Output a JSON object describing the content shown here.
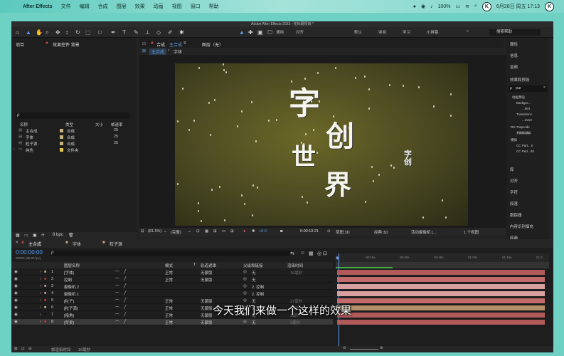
{
  "menubar": {
    "apple": "",
    "app": "After Effects",
    "items": [
      "文件",
      "编辑",
      "合成",
      "图层",
      "效果",
      "动画",
      "视图",
      "窗口",
      "帮助"
    ],
    "battery": "100%",
    "datetime": "6月28日 周五 17:13"
  },
  "window": {
    "title": "Adobe After Effects 2023 - 无标题项目 *"
  },
  "toolbar": {
    "snap": "通用",
    "align": "对齐",
    "workspaces": [
      "默认",
      "审阅",
      "学习",
      "小屏幕"
    ],
    "search_help": "搜索帮助"
  },
  "project": {
    "tab": "项目",
    "tab2": "效果控件 背景",
    "search": "ρ",
    "headers": {
      "name": "名称",
      "type": "类型",
      "size": "大小",
      "fps": "帧速率"
    },
    "items": [
      {
        "name": "主合成",
        "color": "#c8b27a",
        "type": "合成",
        "fps": "25"
      },
      {
        "name": "字体",
        "color": "#c8b27a",
        "type": "合成",
        "fps": "25"
      },
      {
        "name": "粒子源",
        "color": "#c8b27a",
        "type": "合成",
        "fps": "25"
      },
      {
        "name": "纯色",
        "color": "#e8c84a",
        "type": "文件夹",
        "fps": ""
      }
    ],
    "bpc": "8 bpc"
  },
  "comp": {
    "tab": "合成",
    "comp_name": "主合成",
    "footage": "图层（无）",
    "crumb1": "主合成",
    "crumb2": "字体",
    "zoom": "(81.5%)",
    "res": "(完整)",
    "exposure": "+0.0",
    "timecode": "0:00:10:21",
    "renderer": "草图 3D",
    "view3d": "经典 3D",
    "camera": "活动摄像机 (...",
    "views": "1 个视图"
  },
  "title_chars": [
    "字",
    "创",
    "世",
    "界"
  ],
  "right": {
    "items": [
      "属性",
      "信息",
      "音频",
      "效果和预设"
    ],
    "search": "par",
    "tree": [
      "动画预设",
      "Backgro...",
      "...ient",
      "Transitions",
      "...ment",
      "RG Trapcode",
      "Particular",
      "模拟",
      "CC Part... II",
      "CC Part...rld"
    ],
    "lower": [
      "库",
      "对齐",
      "字符",
      "段落",
      "跟踪器",
      "内容识别填充",
      "绘画"
    ]
  },
  "timeline": {
    "tabs": [
      "主合成",
      "字体",
      "粒子源"
    ],
    "timecode": "0:00:00:00",
    "fps_sub": "00000 (25.00 fps)",
    "headers": {
      "name": "图层名称",
      "mode": "模式",
      "t": "T",
      "trkmat": "轨道遮罩",
      "parent": "父级和链接",
      "render": "渲染时间"
    },
    "ruler": [
      "0s",
      "00:15s",
      "00:30s",
      "00:45s",
      "01:00s",
      "01:15s",
      "01:3"
    ],
    "layers": [
      {
        "num": "1",
        "name": "[字体]",
        "color": "#c8b27a",
        "mode": "正常",
        "trk": "无蒙版",
        "parent": "无",
        "render": "16毫秒"
      },
      {
        "num": "2",
        "name": "控制",
        "color": "#c33",
        "mode": "正常",
        "trk": "无蒙版",
        "parent": "无",
        "render": ""
      },
      {
        "num": "3",
        "name": "摄像机 2",
        "color": "#d99",
        "mode": "",
        "trk": "",
        "parent": "2. 控制",
        "render": ""
      },
      {
        "num": "4",
        "name": "摄像机 1",
        "color": "#d99",
        "mode": "",
        "trk": "",
        "parent": "2. 控制",
        "render": ""
      },
      {
        "num": "5",
        "name": "[粒子]",
        "color": "#c33",
        "mode": "正常",
        "trk": "无蒙版",
        "parent": "无",
        "render": "27毫秒"
      },
      {
        "num": "6",
        "name": "[粒子源]",
        "color": "#c8b27a",
        "mode": "正常",
        "trk": "无蒙版",
        "parent": "无",
        "render": "2毫秒"
      },
      {
        "num": "7",
        "name": "[暗角]",
        "color": "#111",
        "mode": "正常",
        "trk": "无蒙版",
        "parent": "无",
        "render": "3毫秒"
      },
      {
        "num": "8",
        "name": "[背景]",
        "color": "#c33",
        "mode": "正常",
        "trk": "无蒙版",
        "parent": "无",
        "render": "3毫秒"
      }
    ],
    "frame_time": "帧渲染时间",
    "frame_ms": "16毫秒"
  },
  "subtitle": "今天我们来做一个这样的效果"
}
